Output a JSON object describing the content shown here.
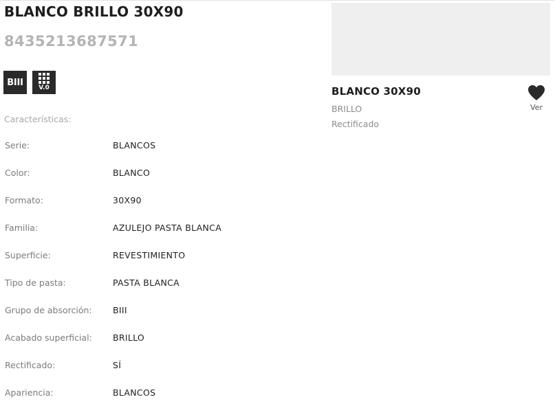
{
  "product": {
    "title": "BLANCO BRILLO 30X90",
    "ean": "8435213687571",
    "badges": {
      "absorption": "BIII",
      "volume_label": "V.0"
    }
  },
  "characteristics": {
    "heading": "Características:",
    "rows": [
      {
        "label": "Serie:",
        "value": "BLANCOS"
      },
      {
        "label": "Color:",
        "value": "BLANCO"
      },
      {
        "label": "Formato:",
        "value": "30X90"
      },
      {
        "label": "Familia:",
        "value": "AZULEJO PASTA BLANCA"
      },
      {
        "label": "Superficie:",
        "value": "REVESTIMIENTO"
      },
      {
        "label": "Tipo de pasta:",
        "value": "PASTA BLANCA"
      },
      {
        "label": "Grupo de absorción:",
        "value": "BIII"
      },
      {
        "label": "Acabado superficial:",
        "value": "BRILLO"
      },
      {
        "label": "Rectificado:",
        "value": "SÍ"
      },
      {
        "label": "Apariencia:",
        "value": "BLANCOS"
      }
    ]
  },
  "card": {
    "title": "BLANCO 30X90",
    "finish": "BRILLO",
    "edge": "Rectificado",
    "favorite_label": "Ver",
    "favorite_icon": "heart-icon"
  },
  "colors": {
    "text_dark": "#1e1e1e",
    "text_muted": "#7b7b7b",
    "ean_gray": "#b4b4b4",
    "badge_bg": "#2a2a2a",
    "image_placeholder": "#efefef"
  }
}
